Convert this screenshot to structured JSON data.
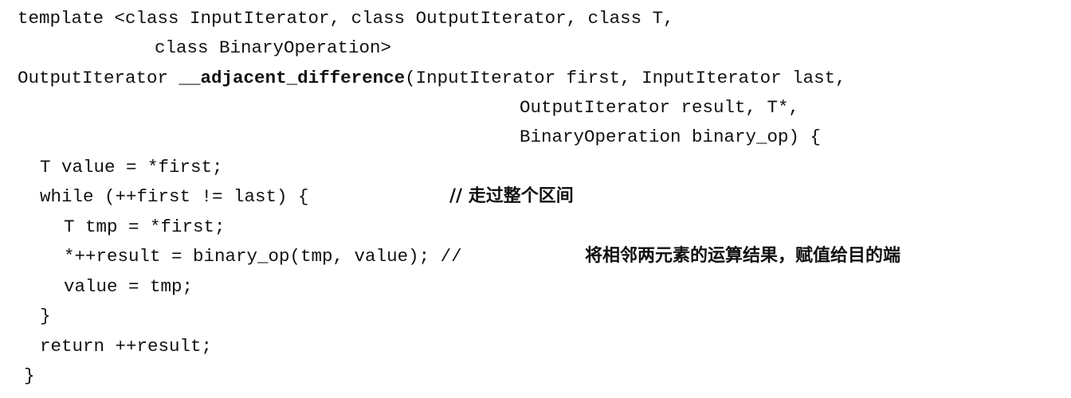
{
  "code_listing": {
    "line1": "template <class InputIterator, class OutputIterator, class T,",
    "line2": "class BinaryOperation>",
    "line3_prefix": "OutputIterator ",
    "line3_func": "__adjacent_difference",
    "line3_suffix": "(InputIterator first, InputIterator last,",
    "line4": "OutputIterator result, T*,",
    "line5": "BinaryOperation binary_op) {",
    "line6": "T value = *first;",
    "line7_code": "while (++first != last) {",
    "line7_comment": "// 走过整个区间",
    "line8": "T tmp = *first;",
    "line9_code": "*++result = binary_op(tmp, value); //",
    "line9_comment": "将相邻两元素的运算结果，赋值给目的端",
    "line10": "value = tmp;",
    "line11": "}",
    "line12": "return ++result;",
    "line13": "}"
  }
}
